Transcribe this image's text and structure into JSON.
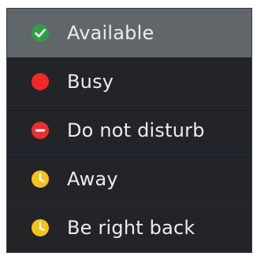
{
  "status_menu": {
    "items": [
      {
        "label": "Available",
        "icon": "check-circle-icon",
        "color": "#2f9f44",
        "selected": true
      },
      {
        "label": "Busy",
        "icon": "filled-circle-icon",
        "color": "#f22727",
        "selected": false
      },
      {
        "label": "Do not disturb",
        "icon": "minus-circle-icon",
        "color": "#ea2f2f",
        "selected": false
      },
      {
        "label": "Away",
        "icon": "clock-circle-icon",
        "color": "#f5c21b",
        "selected": false
      },
      {
        "label": "Be right back",
        "icon": "clock-circle-icon",
        "color": "#f5c21b",
        "selected": false
      }
    ]
  },
  "colors": {
    "menu_background": "#232428",
    "selected_background": "#61666b",
    "text": "#e9edf1",
    "divider": "#163247"
  }
}
